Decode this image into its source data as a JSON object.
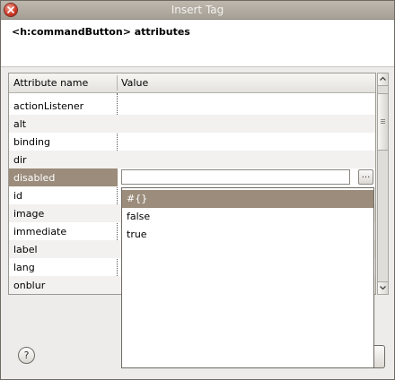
{
  "window": {
    "title": "Insert Tag",
    "close_icon": "close-icon"
  },
  "header": {
    "text": "<h:commandButton> attributes"
  },
  "table": {
    "columns": [
      "Attribute name",
      "Value"
    ],
    "rows": [
      {
        "name": "actionListener",
        "value": ""
      },
      {
        "name": "alt",
        "value": ""
      },
      {
        "name": "binding",
        "value": ""
      },
      {
        "name": "dir",
        "value": ""
      },
      {
        "name": "disabled",
        "value": "",
        "selected": true
      },
      {
        "name": "id",
        "value": ""
      },
      {
        "name": "image",
        "value": ""
      },
      {
        "name": "immediate",
        "value": ""
      },
      {
        "name": "label",
        "value": ""
      },
      {
        "name": "lang",
        "value": ""
      },
      {
        "name": "onblur",
        "value": ""
      }
    ],
    "browse_label": "..."
  },
  "popup": {
    "options": [
      "#{}",
      "false",
      "true"
    ],
    "highlighted_index": 0
  },
  "footer": {
    "help_label": "?"
  },
  "colors": {
    "selection": "#9b8c7b",
    "title_bar": "#a59f95"
  }
}
